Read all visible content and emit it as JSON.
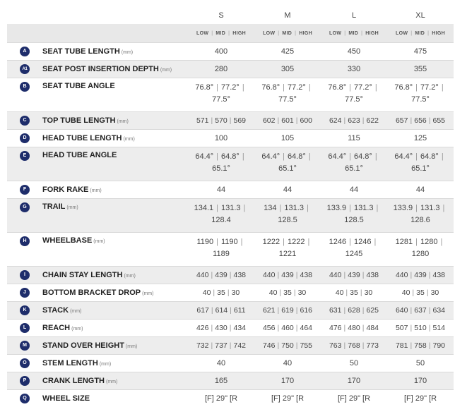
{
  "sizes": [
    "S",
    "M",
    "L",
    "XL"
  ],
  "modes": [
    "LOW",
    "MID",
    "HIGH"
  ],
  "rows": [
    {
      "badge": "A",
      "label": "SEAT TUBE LENGTH",
      "unit": "(mm)",
      "kind": "single",
      "vals": [
        "400",
        "425",
        "450",
        "475"
      ]
    },
    {
      "badge": "A1",
      "label": "SEAT POST INSERTION DEPTH",
      "unit": "(mm)",
      "kind": "single",
      "vals": [
        "280",
        "305",
        "330",
        "355"
      ]
    },
    {
      "badge": "B",
      "label": "SEAT TUBE ANGLE",
      "unit": "",
      "kind": "double",
      "vals": [
        [
          "76.8°",
          "77.2°",
          "77.5°"
        ],
        [
          "76.8°",
          "77.2°",
          "77.5°"
        ],
        [
          "76.8°",
          "77.2°",
          "77.5°"
        ],
        [
          "76.8°",
          "77.2°",
          "77.5°"
        ]
      ]
    },
    {
      "badge": "C",
      "label": "TOP TUBE LENGTH",
      "unit": "(mm)",
      "kind": "triple",
      "vals": [
        [
          "571",
          "570",
          "569"
        ],
        [
          "602",
          "601",
          "600"
        ],
        [
          "624",
          "623",
          "622"
        ],
        [
          "657",
          "656",
          "655"
        ]
      ]
    },
    {
      "badge": "D",
      "label": "HEAD TUBE LENGTH",
      "unit": "(mm)",
      "kind": "single",
      "vals": [
        "100",
        "105",
        "115",
        "125"
      ]
    },
    {
      "badge": "E",
      "label": "HEAD TUBE ANGLE",
      "unit": "",
      "kind": "double",
      "vals": [
        [
          "64.4°",
          "64.8°",
          "65.1°"
        ],
        [
          "64.4°",
          "64.8°",
          "65.1°"
        ],
        [
          "64.4°",
          "64.8°",
          "65.1°"
        ],
        [
          "64.4°",
          "64.8°",
          "65.1°"
        ]
      ]
    },
    {
      "badge": "F",
      "label": "FORK RAKE",
      "unit": "(mm)",
      "kind": "single",
      "vals": [
        "44",
        "44",
        "44",
        "44"
      ]
    },
    {
      "badge": "G",
      "label": "TRAIL",
      "unit": "(mm)",
      "kind": "double",
      "vals": [
        [
          "134.1",
          "131.3",
          "128.4"
        ],
        [
          "134",
          "131.3",
          "128.5"
        ],
        [
          "133.9",
          "131.3",
          "128.5"
        ],
        [
          "133.9",
          "131.3",
          "128.6"
        ]
      ]
    },
    {
      "badge": "H",
      "label": "WHEELBASE",
      "unit": "(mm)",
      "kind": "double",
      "vals": [
        [
          "1190",
          "1190",
          "1189"
        ],
        [
          "1222",
          "1222",
          "1221"
        ],
        [
          "1246",
          "1246",
          "1245"
        ],
        [
          "1281",
          "1280",
          "1280"
        ]
      ]
    },
    {
      "badge": "I",
      "label": "CHAIN STAY LENGTH",
      "unit": "(mm)",
      "kind": "triple",
      "vals": [
        [
          "440",
          "439",
          "438"
        ],
        [
          "440",
          "439",
          "438"
        ],
        [
          "440",
          "439",
          "438"
        ],
        [
          "440",
          "439",
          "438"
        ]
      ]
    },
    {
      "badge": "J",
      "label": "BOTTOM BRACKET DROP",
      "unit": "(mm)",
      "kind": "triple",
      "vals": [
        [
          "40",
          "35",
          "30"
        ],
        [
          "40",
          "35",
          "30"
        ],
        [
          "40",
          "35",
          "30"
        ],
        [
          "40",
          "35",
          "30"
        ]
      ]
    },
    {
      "badge": "K",
      "label": "STACK",
      "unit": "(mm)",
      "kind": "triple",
      "vals": [
        [
          "617",
          "614",
          "611"
        ],
        [
          "621",
          "619",
          "616"
        ],
        [
          "631",
          "628",
          "625"
        ],
        [
          "640",
          "637",
          "634"
        ]
      ]
    },
    {
      "badge": "L",
      "label": "REACH",
      "unit": "(mm)",
      "kind": "triple",
      "vals": [
        [
          "426",
          "430",
          "434"
        ],
        [
          "456",
          "460",
          "464"
        ],
        [
          "476",
          "480",
          "484"
        ],
        [
          "507",
          "510",
          "514"
        ]
      ]
    },
    {
      "badge": "M",
      "label": "STAND OVER HEIGHT",
      "unit": "(mm)",
      "kind": "triple",
      "vals": [
        [
          "732",
          "737",
          "742"
        ],
        [
          "746",
          "750",
          "755"
        ],
        [
          "763",
          "768",
          "773"
        ],
        [
          "781",
          "758",
          "790"
        ]
      ]
    },
    {
      "badge": "O",
      "label": "STEM LENGTH",
      "unit": "(mm)",
      "kind": "single",
      "vals": [
        "40",
        "40",
        "50",
        "50"
      ]
    },
    {
      "badge": "P",
      "label": "CRANK LENGTH",
      "unit": "(mm)",
      "kind": "single",
      "vals": [
        "165",
        "170",
        "170",
        "170"
      ]
    },
    {
      "badge": "Q",
      "label": "WHEEL SIZE",
      "unit": "",
      "kind": "single",
      "vals": [
        "[F] 29\" [R",
        "[F] 29\" [R",
        "[F] 29\" [R",
        "[F] 29\" [R"
      ]
    }
  ],
  "colors": {
    "badge": "#1e2d6b",
    "header_band": "#e8e8e8",
    "stripe": "#ededed"
  }
}
